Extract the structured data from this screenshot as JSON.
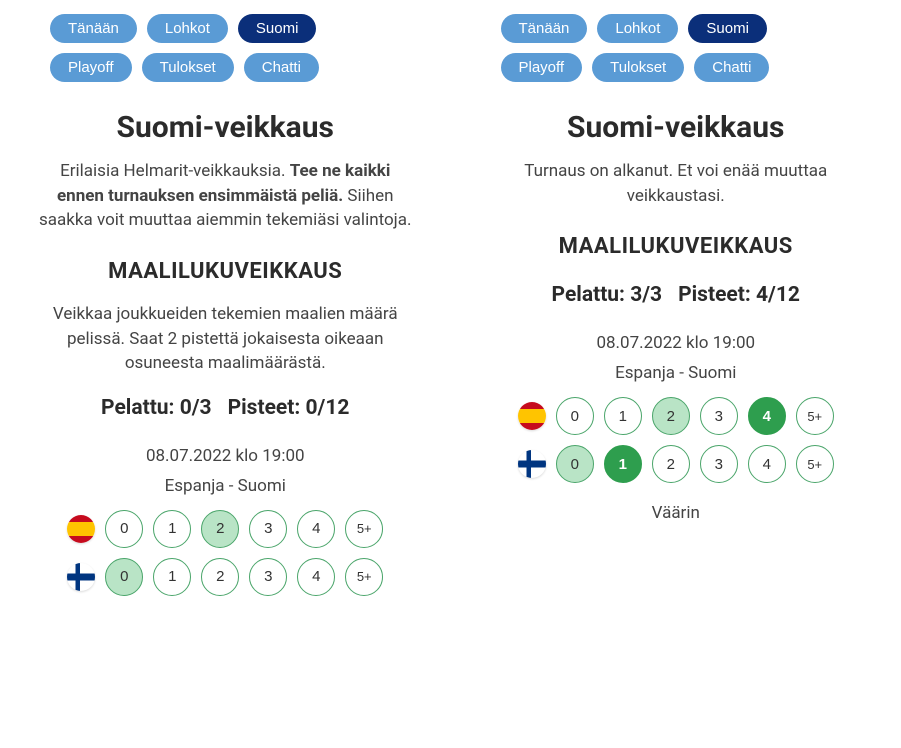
{
  "tabs": {
    "t0": "Tänään",
    "t1": "Lohkot",
    "t2": "Suomi",
    "t3": "Playoff",
    "t4": "Tulokset",
    "t5": "Chatti"
  },
  "left": {
    "title": "Suomi-veikkaus",
    "intro_pre": "Erilaisia Helmarit-veikkauksia. ",
    "intro_bold": "Tee ne kaikki ennen turnauksen ensimmäistä peliä.",
    "intro_post": " Siihen saakka voit muuttaa aiemmin tekemiäsi valintoja.",
    "section": "MAALILUKUVEIKKAUS",
    "body": "Veikkaa joukkueiden tekemien maalien määrä pelissä. Saat 2 pistettä jokaisesta oikeaan osuneesta maalimäärästä.",
    "played": "Pelattu: 0/3",
    "points": "Pisteet: 0/12",
    "date": "08.07.2022 klo 19:00",
    "teams": "Espanja - Suomi",
    "options": [
      "0",
      "1",
      "2",
      "3",
      "4",
      "5+"
    ],
    "row1_selected": 2,
    "row2_selected": 0
  },
  "right": {
    "title": "Suomi-veikkaus",
    "intro": "Turnaus on alkanut. Et voi enää muuttaa veikkaustasi.",
    "section": "MAALILUKUVEIKKAUS",
    "played": "Pelattu: 3/3",
    "points": "Pisteet: 4/12",
    "date": "08.07.2022 klo 19:00",
    "teams": "Espanja - Suomi",
    "options": [
      "0",
      "1",
      "2",
      "3",
      "4",
      "5+"
    ],
    "row1_guess": 2,
    "row1_actual": 4,
    "row2_guess": 0,
    "row2_actual": 1,
    "result": "Väärin"
  }
}
